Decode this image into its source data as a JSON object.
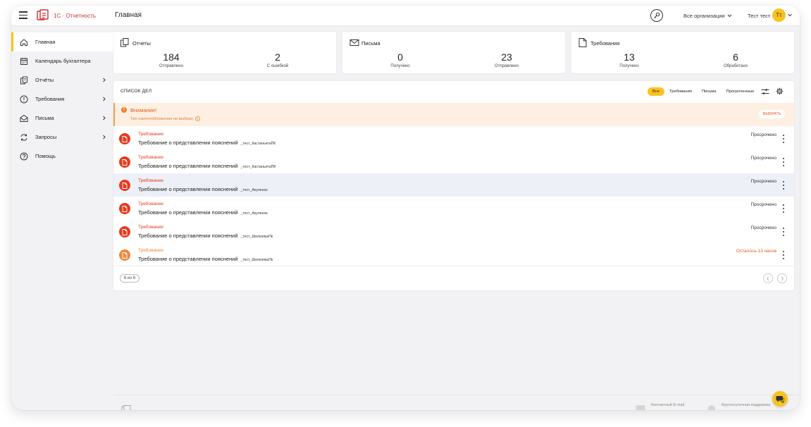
{
  "header": {
    "brand": "1С · Отчетность",
    "page_title": "Главная",
    "org_select": "Все организации",
    "user_name": "Тест тест",
    "avatar_initials": "Тт"
  },
  "sidebar": {
    "items": [
      {
        "label": "Главная",
        "icon": "home-icon",
        "active": true
      },
      {
        "label": "Календарь бухгалтера",
        "icon": "calendar-icon"
      },
      {
        "label": "Отчёты",
        "icon": "reports-icon",
        "expandable": true
      },
      {
        "label": "Требования",
        "icon": "alert-circle-icon",
        "expandable": true
      },
      {
        "label": "Письма",
        "icon": "mail-open-icon",
        "expandable": true
      },
      {
        "label": "Запросы",
        "icon": "sync-icon",
        "expandable": true
      },
      {
        "label": "Помощь",
        "icon": "help-icon"
      }
    ]
  },
  "stats": {
    "reports": {
      "title": "Отчеты",
      "a_value": "184",
      "a_label": "Отправлено",
      "b_value": "2",
      "b_label": "С ошибкой"
    },
    "letters": {
      "title": "Письма",
      "a_value": "0",
      "a_label": "Получено",
      "b_value": "23",
      "b_label": "Отправлено"
    },
    "demands": {
      "title": "Требования",
      "a_value": "13",
      "a_label": "Получено",
      "b_value": "6",
      "b_label": "Обработано"
    }
  },
  "tasks": {
    "title": "СПИСОК ДЕЛ",
    "filters": [
      "Все",
      "Требования",
      "Письма",
      "Просроченные"
    ],
    "alert": {
      "title": "Внимание!",
      "subtitle": "Тип налогообложения не выбран",
      "button": "ВЫБРАТЬ"
    },
    "rows": [
      {
        "type": "Требование",
        "title": "Требование о представлении пояснений",
        "org": "_тест_КастаньетаПК",
        "status": "Просрочено",
        "warn": false,
        "highlight": false
      },
      {
        "type": "Требование",
        "title": "Требование о представлении пояснений",
        "org": "_тест_КастаньетаПК",
        "status": "Просрочено",
        "warn": false,
        "highlight": false
      },
      {
        "type": "Требование",
        "title": "Требование о представлении пояснений",
        "org": "_тест_Акуленок",
        "status": "Просрочено",
        "warn": false,
        "highlight": true
      },
      {
        "type": "Требование",
        "title": "Требование о представлении пояснений",
        "org": "_тест_Акуленок",
        "status": "Просрочено",
        "warn": false,
        "highlight": false
      },
      {
        "type": "Требование",
        "title": "Требование о представлении пояснений",
        "org": "_тест_ШелезякаПк",
        "status": "Просрочено",
        "warn": false,
        "highlight": false
      },
      {
        "type": "Требование",
        "title": "Требование о представлении пояснений",
        "org": "_тест_ШелезякаПк",
        "status": "Осталось 13 часов",
        "warn": true,
        "highlight": false
      }
    ],
    "count": "6 из 6"
  },
  "footer": {
    "email_label": "Контактный E-mail",
    "support_label": "Круглосуточная поддержка"
  },
  "colors": {
    "accent": "#f9c31f",
    "danger": "#e53a1e",
    "warning": "#f0883a",
    "brand_red": "#d32f2f"
  }
}
